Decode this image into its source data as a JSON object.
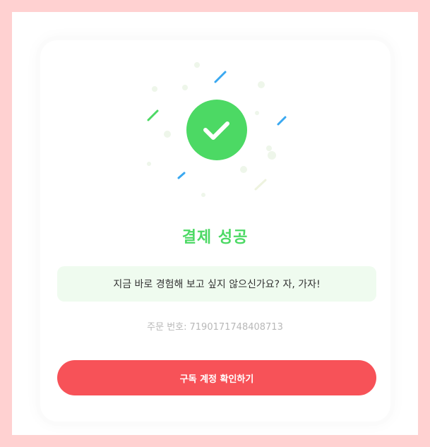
{
  "status": {
    "title": "결제 성공",
    "message": "지금 바로 경험해 보고 싶지 않으신가요? 자, 가자!",
    "order_label": "주문 번호:",
    "order_number": "7190171748408713"
  },
  "actions": {
    "confirm_label": "구독 계정 확인하기"
  },
  "colors": {
    "success": "#4cd964",
    "accent_blue": "#3aa8f0",
    "cta": "#f75258",
    "background": "#ffd1d1"
  },
  "icon": "checkmark-circle-icon"
}
